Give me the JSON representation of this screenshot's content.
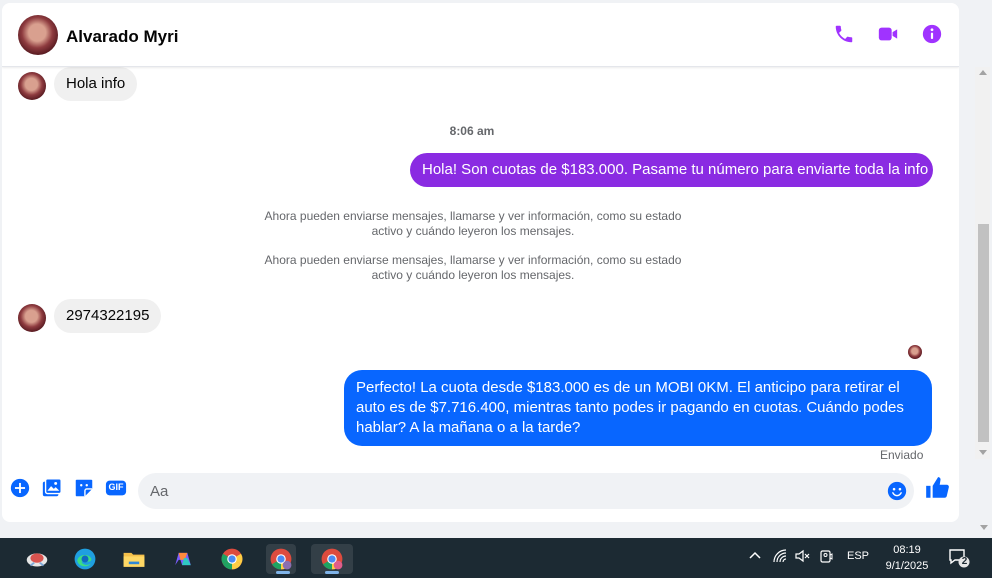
{
  "header": {
    "contact_name": "Alvarado Myri",
    "actions": [
      {
        "icon": "phone-icon"
      },
      {
        "icon": "video-camera-icon"
      },
      {
        "icon": "info-icon"
      }
    ]
  },
  "messages": {
    "incoming_1": "Hola info",
    "timestamp": "8:06 am",
    "outgoing_1": "Hola! Son cuotas de $183.000. Pasame tu número para enviarte toda la info",
    "system_1": "Ahora pueden enviarse mensajes, llamarse y ver información, como su estado activo y cuándo leyeron los mensajes.",
    "system_2": "Ahora pueden enviarse mensajes, llamarse y ver información, como su estado activo y cuándo leyeron los mensajes.",
    "incoming_2": "2974322195",
    "outgoing_2": "Perfecto! La cuota desde $183.000 es de un MOBI 0KM. El anticipo para retirar el auto es de $7.716.400, mientras tanto podes ir pagando en cuotas. Cuándo podes hablar? A la mañana o a la tarde?",
    "status": "Enviado"
  },
  "composer": {
    "placeholder": "Aa",
    "buttons": [
      "plus-icon",
      "photo-icon",
      "sticker-icon",
      "gif-icon"
    ],
    "gif_label": "GIF"
  },
  "taskbar": {
    "language": "ESP",
    "time": "08:19",
    "date": "9/1/2025",
    "notification_count": "2"
  },
  "colors": {
    "accent": "#a033ff",
    "outgoing_purple": "#8a2be2",
    "outgoing_blue": "#0866ff",
    "incoming_bg": "#f0f0f0"
  }
}
